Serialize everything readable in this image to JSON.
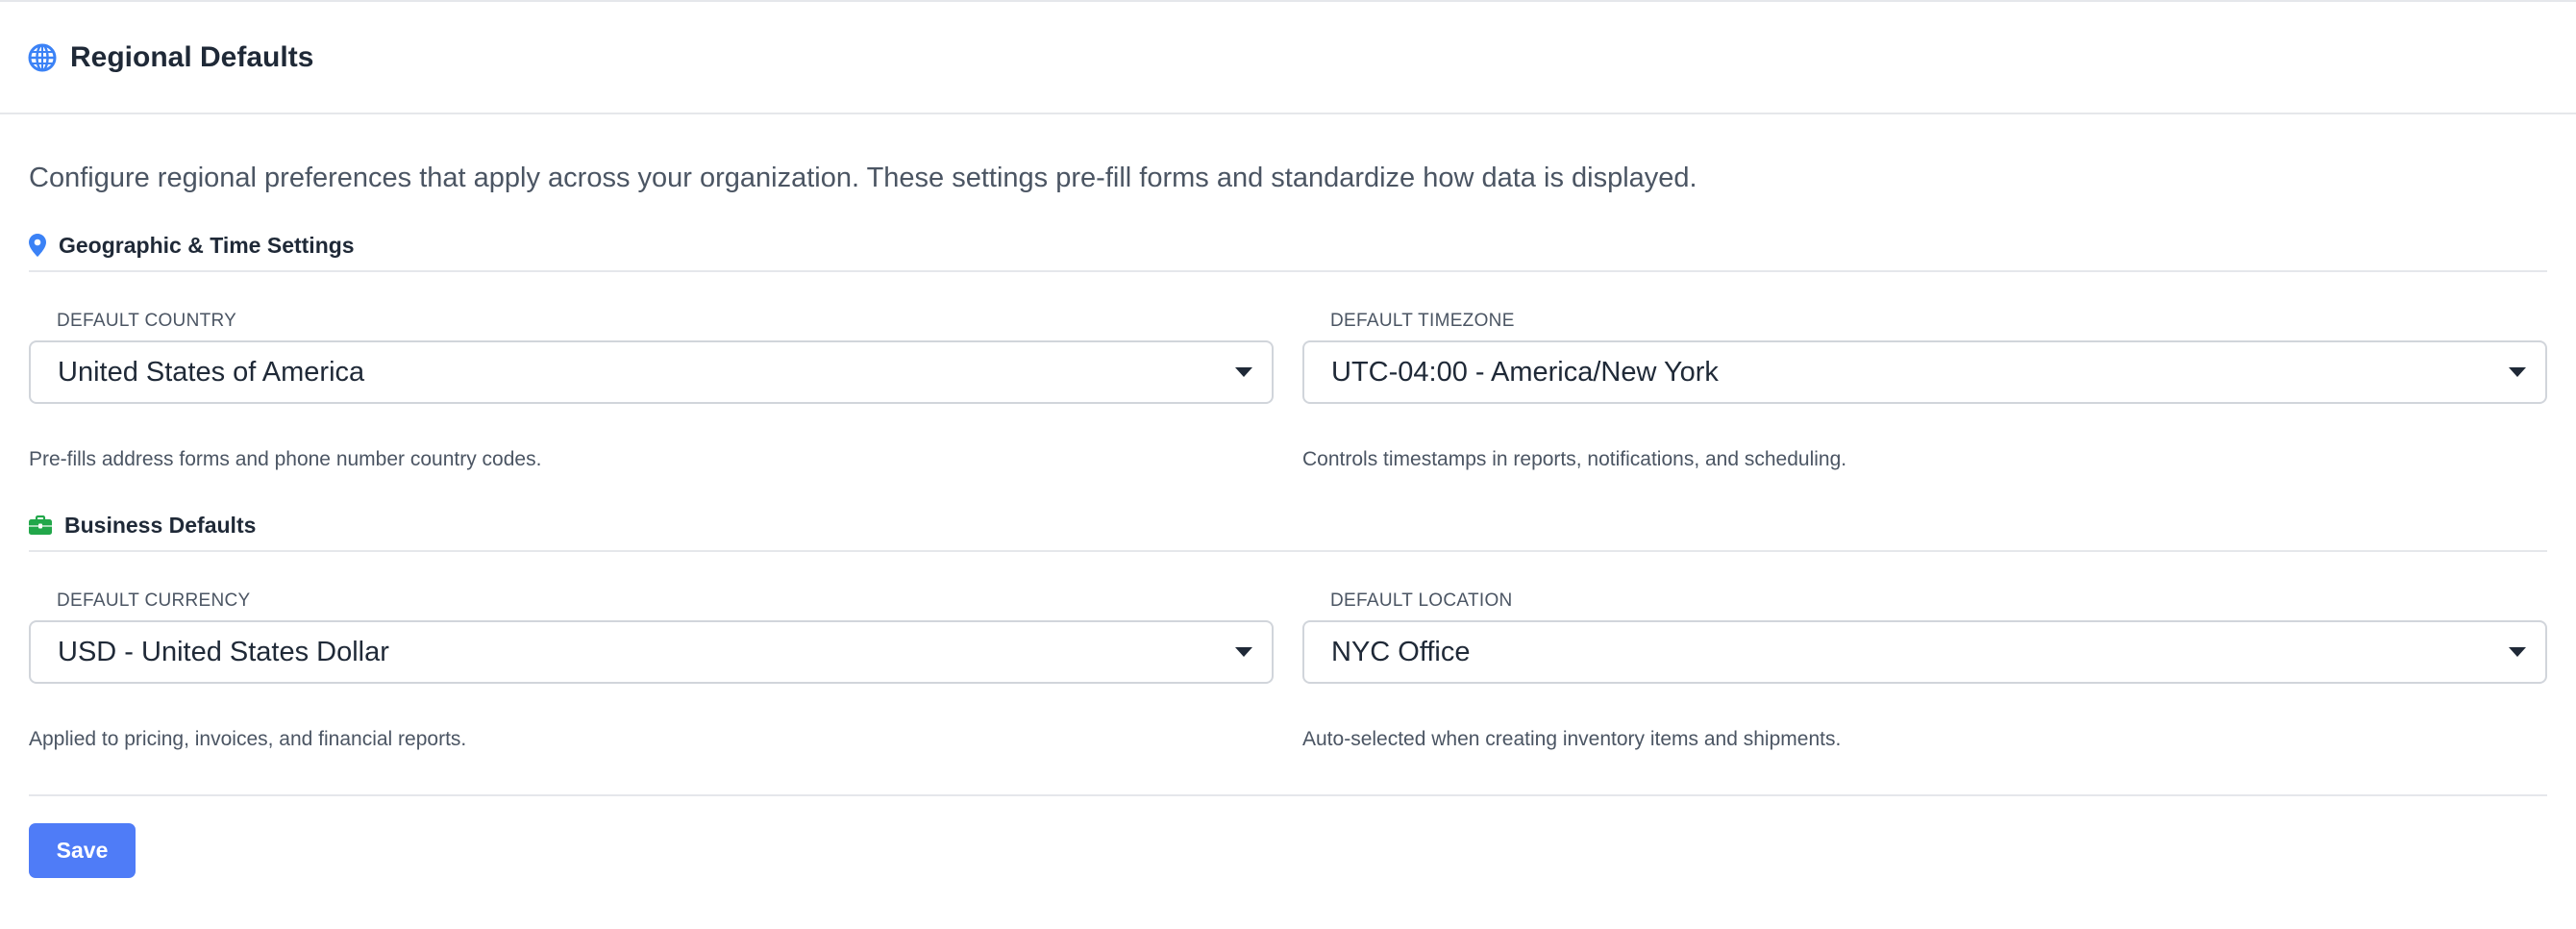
{
  "header": {
    "title": "Regional Defaults",
    "icon": "globe-icon"
  },
  "description": "Configure regional preferences that apply across your organization. These settings pre-fill forms and standardize how data is displayed.",
  "sections": [
    {
      "title": "Geographic & Time Settings",
      "icon": "map-pin-icon",
      "icon_color": "#3b82f6",
      "fields": [
        {
          "label": "DEFAULT COUNTRY",
          "value": "United States of America",
          "help": "Pre-fills address forms and phone number country codes."
        },
        {
          "label": "DEFAULT TIMEZONE",
          "value": "UTC-04:00 - America/New York",
          "help": "Controls timestamps in reports, notifications, and scheduling."
        }
      ]
    },
    {
      "title": "Business Defaults",
      "icon": "briefcase-icon",
      "icon_color": "#22a74a",
      "fields": [
        {
          "label": "DEFAULT CURRENCY",
          "value": "USD - United States Dollar",
          "help": "Applied to pricing, invoices, and financial reports."
        },
        {
          "label": "DEFAULT LOCATION",
          "value": "NYC Office",
          "help": "Auto-selected when creating inventory items and shipments."
        }
      ]
    }
  ],
  "actions": {
    "save_label": "Save"
  },
  "colors": {
    "accent": "#4f7cf7",
    "border": "#e5e7eb",
    "text": "#1f2937",
    "muted": "#4b5563"
  }
}
